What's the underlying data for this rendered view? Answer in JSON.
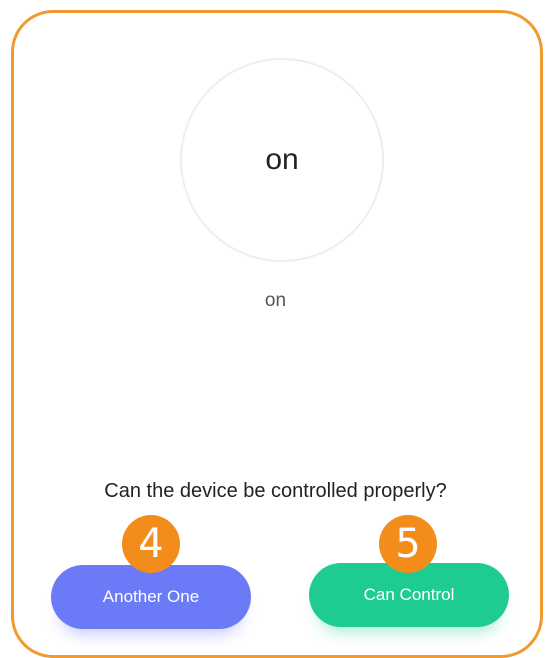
{
  "colors": {
    "frame_border": "#F39A2E",
    "badge": "#F28C1B",
    "another_button": "#6B7BF7",
    "control_button": "#1FCC8F"
  },
  "switch": {
    "label": "on"
  },
  "status": {
    "text": "on"
  },
  "prompt": {
    "question": "Can the device be controlled properly?"
  },
  "buttons": {
    "another_one": "Another One",
    "can_control": "Can Control"
  },
  "badges": {
    "step_4": "4",
    "step_5": "5"
  }
}
